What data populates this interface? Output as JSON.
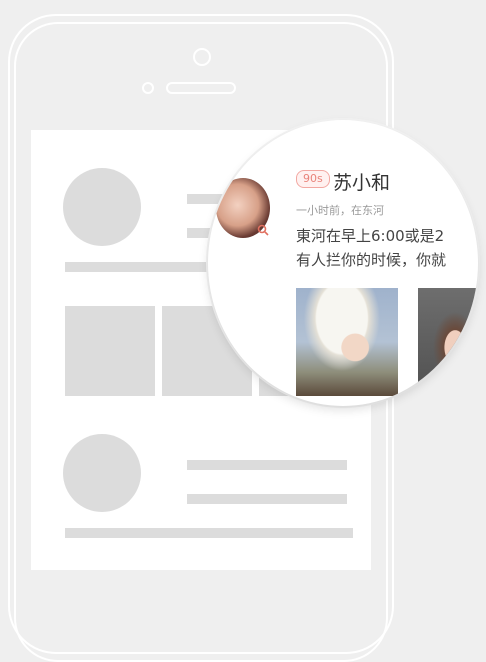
{
  "profile": {
    "age_badge": "90s",
    "name": "苏小和",
    "meta": "一小时前，在东河"
  },
  "post": {
    "line1": "東河在早上6:00或是2",
    "line2": "有人拦你的时候，你就"
  },
  "icons": {
    "search": "search-icon"
  },
  "colors": {
    "background": "#efefef",
    "placeholder": "#dcdcdc",
    "badge": "#e9837a"
  }
}
